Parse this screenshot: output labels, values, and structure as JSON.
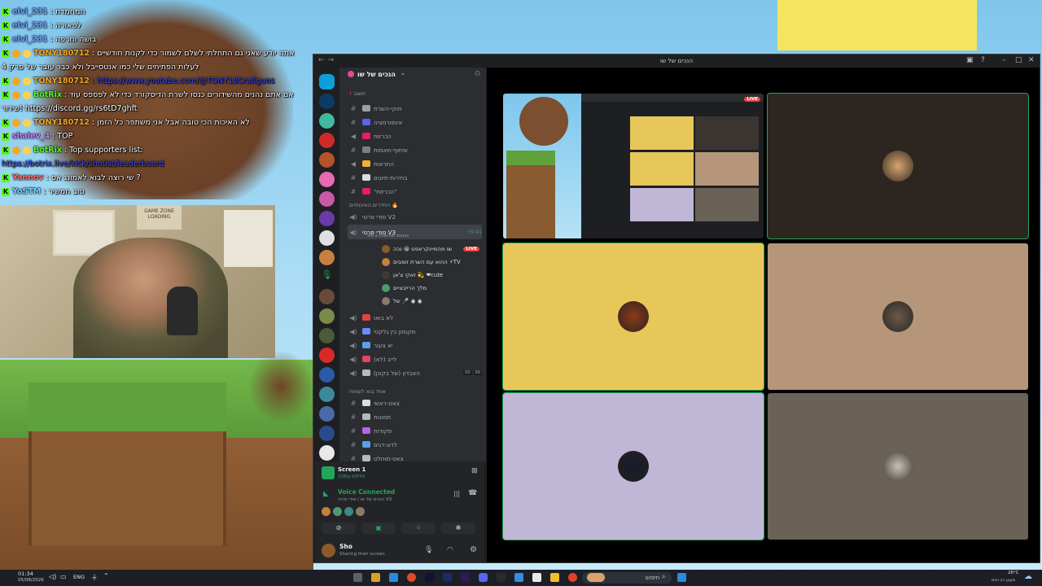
{
  "chat": [
    {
      "user": "elvi_231",
      "color": "#6b9bff",
      "msg": ": המחמדת",
      "badges": [
        "K"
      ]
    },
    {
      "user": "elvi_231",
      "color": "#6b9bff",
      "msg": ": לפאורה",
      "badges": [
        "K"
      ]
    },
    {
      "user": "elvi_231",
      "color": "#6b9bff",
      "msg": ": בושה וחרפה",
      "badges": [
        "K"
      ]
    },
    {
      "user": "TONY180712",
      "color": "#f5a623",
      "msg": ": אתה יודע שאני גם התחלתי לשלם לשמור כדי לקנות חודשיים",
      "badges": [
        "K",
        "S",
        "C"
      ]
    },
    {
      "user": "",
      "color": "#ffffff",
      "msg": "לעלות הפתיחים שלי כמו אנטסייבל ולא כבר עובר של פרק 4",
      "badges": []
    },
    {
      "user": "TONY180712",
      "color": "#f5a623",
      "msg": ": https://www.youtube.com/@TONY18Crafiguos",
      "badges": [
        "K",
        "S",
        "C"
      ],
      "link": true
    },
    {
      "user": "BotRix",
      "color": "#53fc18",
      "msg": ": אם אתם נהנים מהשידורים כנסו לשרת הדיסקורד כדי לא לפספס עוד",
      "badges": [
        "K",
        "S",
        "C"
      ]
    },
    {
      "user": "",
      "color": "#ffffff",
      "msg": "שידור! https://discord.gg/rs6tD7ghft",
      "badges": []
    },
    {
      "user": "TONY180712",
      "color": "#f5a623",
      "msg": ": לא האיכות הכי טובה אבל אני משתפר כל הזמן",
      "badges": [
        "K",
        "S",
        "C"
      ]
    },
    {
      "user": "shalev_4",
      "color": "#c97bff",
      "msg": ": TOP",
      "badges": [
        "K"
      ]
    },
    {
      "user": "BotRix",
      "color": "#53fc18",
      "msg": ": Top supporters list:",
      "badges": [
        "K",
        "S",
        "C"
      ]
    },
    {
      "user": "",
      "color": "#ffffff",
      "msg": "https://botrix.live/kick/shotist/leaderboard",
      "badges": [],
      "link": true
    },
    {
      "user": "Yannov",
      "color": "#ff6b6b",
      "msg": ": שי רוצה לבוא לאמונג אס ?",
      "badges": [
        "K"
      ]
    },
    {
      "user": "YoSTM",
      "color": "#7bd3ff",
      "msg": ": טוב חמשיר",
      "badges": [
        "K"
      ]
    }
  ],
  "webcam": {
    "sign_text": "GAME ZONE\nLOADING"
  },
  "discord": {
    "window_title": "הנכים של שו",
    "server_name": "הנכים של שו",
    "channels_top": [
      {
        "label": "חשוב",
        "type": "cat"
      },
      {
        "label": "חוקי-השרת",
        "type": "text",
        "color": "#a0a0a0"
      },
      {
        "label": "אינפורמציה",
        "type": "text",
        "color": "#5865f2"
      },
      {
        "label": "הכרזות",
        "type": "speaker",
        "color": "#e91e63"
      },
      {
        "label": "שיתוף-מאמות",
        "type": "text",
        "color": "#7a7f86"
      },
      {
        "label": "התראות",
        "type": "speaker",
        "color": "#f0b232"
      },
      {
        "label": "בחירות-תיוגים",
        "type": "text",
        "color": "#dbdee1"
      },
      {
        "label": "\"הכרזות\"",
        "type": "text",
        "color": "#e91e63"
      }
    ],
    "voice_category": "החדרים האיכותיים 🔥",
    "voice_channels": [
      {
        "label": "סודי פרטי V2",
        "type": "voice"
      },
      {
        "label": "סודי פרטי V3",
        "type": "voice",
        "active": true,
        "time": "59:41",
        "status": "Set a channel status"
      }
    ],
    "voice_users": [
      {
        "name": "שו מהמיינקראפט 😀 נכה",
        "live": "LIVE",
        "color": "#8b5a2b"
      },
      {
        "name": "ההוא עם השרת זומבים ⚡TV",
        "color": "#c4813f"
      },
      {
        "name": "זאקי צ'אן 💫 ❤cute",
        "color": "#3b3b3b"
      },
      {
        "name": "מלך הרייבציים",
        "color": "#4e9a6b"
      },
      {
        "name": "של 🎤 ◉ ◉",
        "color": "#8a7a6a"
      }
    ],
    "channels_mid": [
      {
        "label": "לא בואו",
        "type": "voice",
        "color": "#e24444"
      },
      {
        "label": "מקומון בין גלקטי",
        "type": "voice",
        "color": "#6a8cff"
      },
      {
        "label": "יא צעור",
        "type": "voice",
        "color": "#5aa0e8"
      },
      {
        "label": "לייב (לא)",
        "type": "voice",
        "color": "#e24466"
      },
      {
        "label": "האבדון (של בקונן)",
        "type": "voice",
        "color": "#b5bac1",
        "counts": [
          "00",
          "99"
        ]
      }
    ],
    "category2": "אחד בוא לשוחח",
    "channels_bottom": [
      {
        "label": "צאט-ראשי",
        "type": "text",
        "color": "#dbdee1"
      },
      {
        "label": "תמונות",
        "type": "text",
        "color": "#b5bac1"
      },
      {
        "label": "פקודות",
        "type": "text",
        "color": "#b068e8"
      },
      {
        "label": "לדוג-דגים",
        "type": "text",
        "color": "#5aa0e8"
      },
      {
        "label": "צאט-מוחלט",
        "type": "text",
        "color": "#b5bac1"
      }
    ],
    "stream_panel": {
      "title": "Screen 1",
      "sub": "1080p 60FPS"
    },
    "voice_connected": {
      "title": "Voice Connected",
      "sub": "הנכים של שו / סודי פרטי V3"
    },
    "user": {
      "name": "Sho",
      "status": "Sharing their screen"
    },
    "tiles": [
      {
        "kind": "screen",
        "live": "LIVE",
        "bg": "#2b2d31"
      },
      {
        "kind": "avatar",
        "bg": "#2d2620",
        "avatar_color": "#d9a46b"
      },
      {
        "kind": "avatar",
        "bg": "#e8c75a",
        "avatar_color": "#8b3a1a"
      },
      {
        "kind": "avatar",
        "bg": "#b5967a",
        "avatar_color": "#6b5a48"
      },
      {
        "kind": "avatar",
        "bg": "#c0b6d6",
        "avatar_color": "#1a1a2a"
      },
      {
        "kind": "avatar",
        "bg": "#6a6157",
        "avatar_color": "#c9c1b2"
      }
    ]
  },
  "taskbar": {
    "time": "01:34",
    "date": "05/08/2026",
    "lang": "ENG",
    "search_placeholder": "חיפוש",
    "weather_temp": "26°C",
    "weather_text": "מעונן רב היום"
  }
}
